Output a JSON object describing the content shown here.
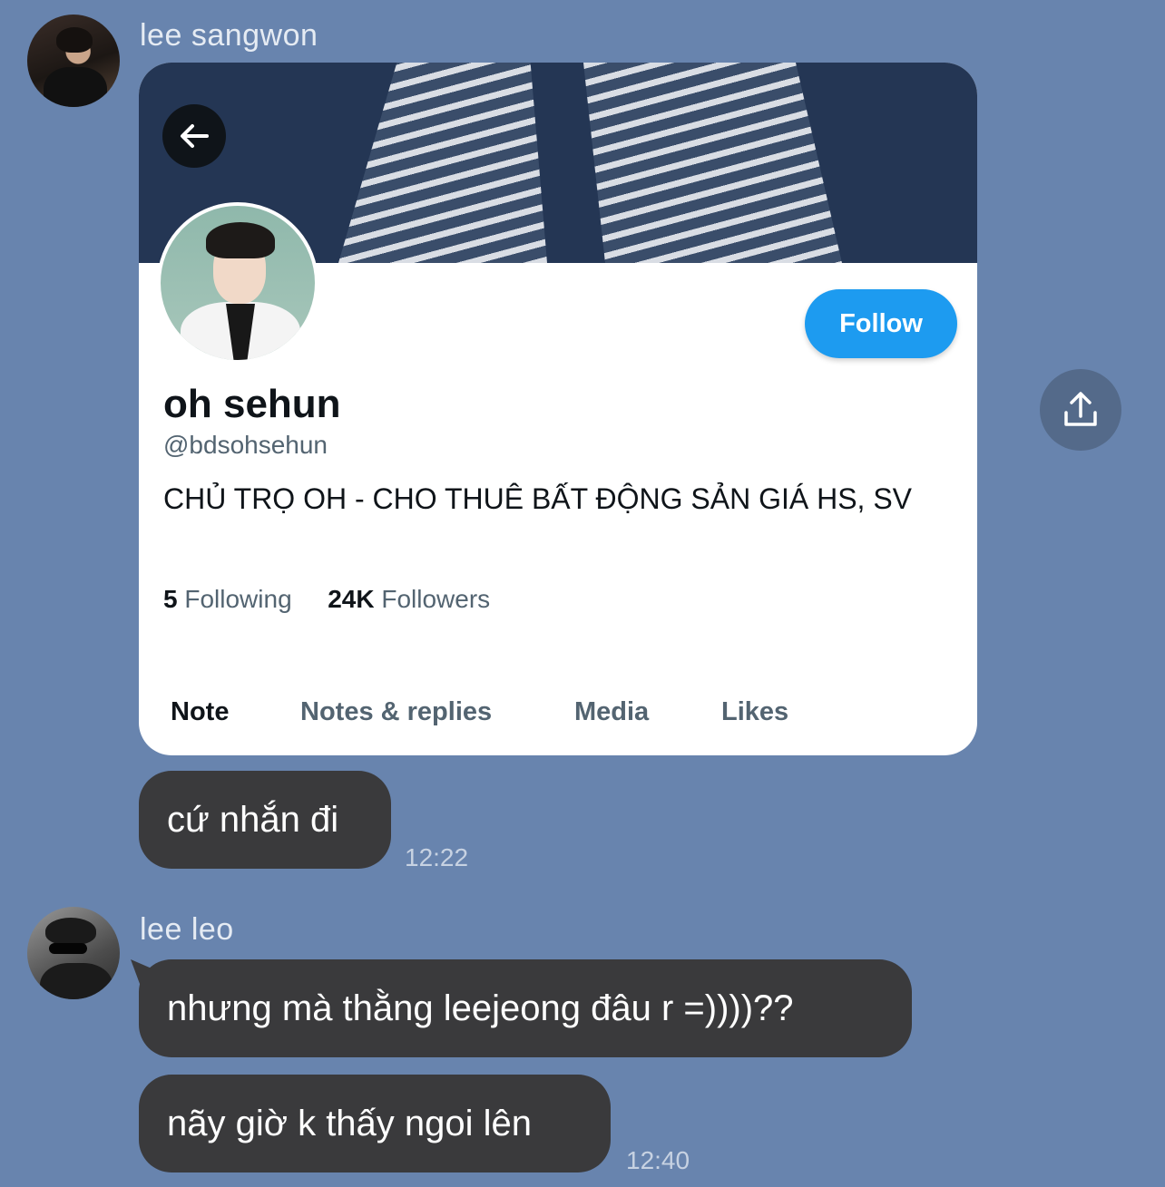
{
  "messages_group1": {
    "sender": "lee sangwon",
    "shared_profile": {
      "display_name": "oh sehun",
      "handle": "@bdsohsehun",
      "bio": "CHỦ TRỌ OH - CHO THUÊ BẤT ĐỘNG SẢN GIÁ HS, SV",
      "following_count": "5",
      "following_label": "Following",
      "followers_count": "24K",
      "followers_label": "Followers",
      "follow_button": "Follow",
      "tabs": [
        "Note",
        "Notes & replies",
        "Media",
        "Likes"
      ],
      "active_tab": "Note"
    },
    "text": "cứ nhắn đi",
    "time": "12:22"
  },
  "messages_group2": {
    "sender": "lee leo",
    "texts": [
      "nhưng mà thằng leejeong đâu r =))))??",
      "nãy giờ k thấy ngoi lên"
    ],
    "time": "12:40"
  },
  "colors": {
    "background": "#6884ae",
    "bubble": "#3a3a3c",
    "follow_button": "#1d9bf0"
  }
}
